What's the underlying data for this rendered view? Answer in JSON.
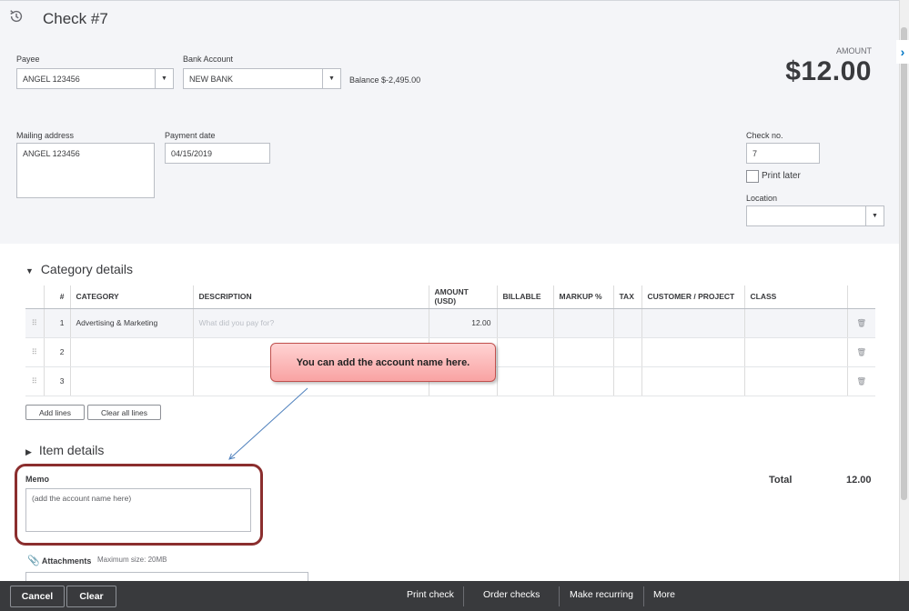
{
  "header": {
    "title": "Check #7"
  },
  "payee": {
    "label": "Payee",
    "value": "ANGEL 123456"
  },
  "bank_account": {
    "label": "Bank Account",
    "value": "NEW BANK",
    "balance_label": "Balance",
    "balance_value": "$-2,495.00"
  },
  "amount": {
    "label": "AMOUNT",
    "value": "$12.00"
  },
  "mailing_address": {
    "label": "Mailing address",
    "value": "ANGEL 123456"
  },
  "payment_date": {
    "label": "Payment date",
    "value": "04/15/2019"
  },
  "check_no": {
    "label": "Check no.",
    "value": "7"
  },
  "print_later": {
    "label": "Print later",
    "checked": false
  },
  "location": {
    "label": "Location",
    "value": ""
  },
  "category_details": {
    "title": "Category details",
    "columns": [
      "#",
      "CATEGORY",
      "DESCRIPTION",
      "AMOUNT (USD)",
      "BILLABLE",
      "MARKUP %",
      "TAX",
      "CUSTOMER / PROJECT",
      "CLASS"
    ],
    "rows": [
      {
        "num": "1",
        "category": "Advertising & Marketing",
        "description_placeholder": "What did you pay for?",
        "amount": "12.00"
      },
      {
        "num": "2",
        "category": "",
        "description_placeholder": "",
        "amount": ""
      },
      {
        "num": "3",
        "category": "",
        "description_placeholder": "",
        "amount": ""
      }
    ],
    "add_lines": "Add lines",
    "clear_all_lines": "Clear all lines"
  },
  "callout": {
    "text": "You can add the account  name here."
  },
  "item_details": {
    "title": "Item details"
  },
  "memo": {
    "label": "Memo",
    "value": "(add the account name here)"
  },
  "total": {
    "label": "Total",
    "value": "12.00"
  },
  "attachments": {
    "label": "Attachments",
    "max_size": "Maximum size: 20MB"
  },
  "footer": {
    "cancel": "Cancel",
    "clear": "Clear",
    "print_check": "Print check",
    "order_checks": "Order checks",
    "make_recurring": "Make recurring",
    "more": "More"
  },
  "colors": {
    "footer_bg": "#393a3d",
    "callout_border": "#c0504d",
    "highlight": "#8b2e2e",
    "link": "#0077c5"
  }
}
